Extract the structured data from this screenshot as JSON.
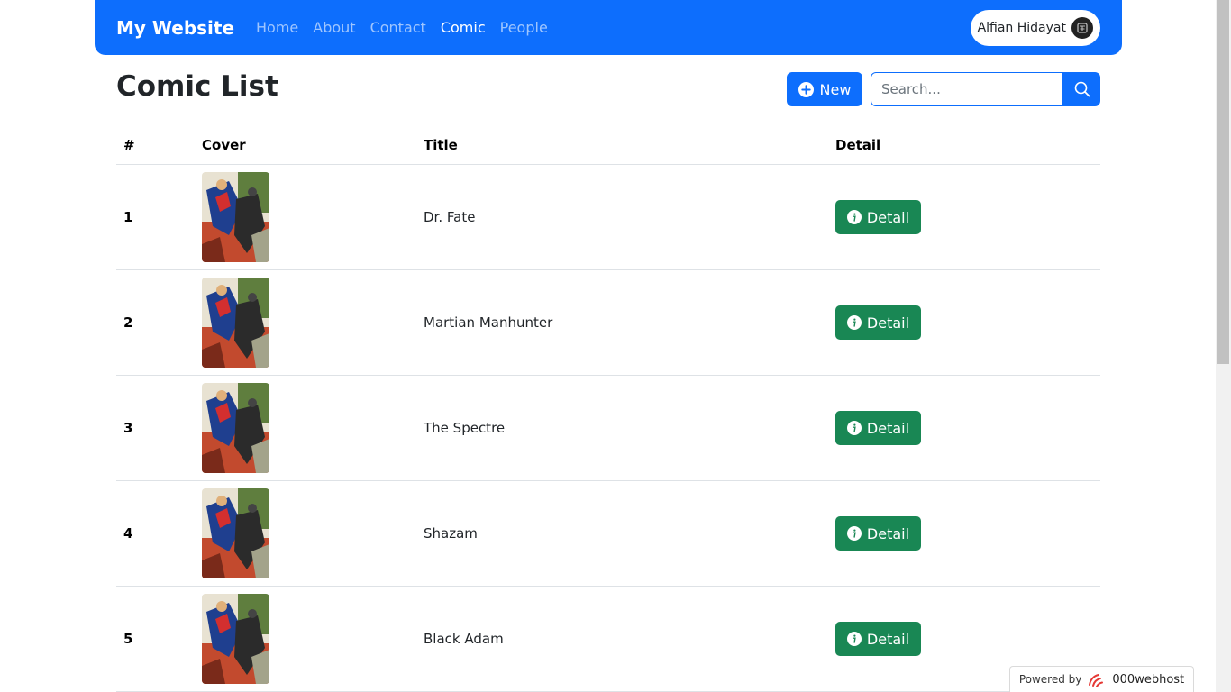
{
  "navbar": {
    "brand": "My Website",
    "links": [
      {
        "label": "Home",
        "active": false
      },
      {
        "label": "About",
        "active": false
      },
      {
        "label": "Contact",
        "active": false
      },
      {
        "label": "Comic",
        "active": true
      },
      {
        "label": "People",
        "active": false
      }
    ],
    "user_name": "Alfian Hidayat"
  },
  "page": {
    "title": "Comic List",
    "new_button": "New",
    "search_placeholder": "Search..."
  },
  "table": {
    "headers": [
      "#",
      "Cover",
      "Title",
      "Detail"
    ],
    "rows": [
      {
        "num": "1",
        "title": "Dr. Fate",
        "action": "Detail"
      },
      {
        "num": "2",
        "title": "Martian Manhunter",
        "action": "Detail"
      },
      {
        "num": "3",
        "title": "The Spectre",
        "action": "Detail"
      },
      {
        "num": "4",
        "title": "Shazam",
        "action": "Detail"
      },
      {
        "num": "5",
        "title": "Black Adam",
        "action": "Detail"
      }
    ]
  },
  "footer": {
    "powered_by": "Powered by",
    "host": "000webhost"
  },
  "colors": {
    "primary": "#0d6efd",
    "success": "#198754"
  },
  "icons": {
    "new": "plus-circle-icon",
    "search": "search-icon",
    "detail": "info-circle-icon",
    "cover": "comic-cover-thumbnail"
  }
}
